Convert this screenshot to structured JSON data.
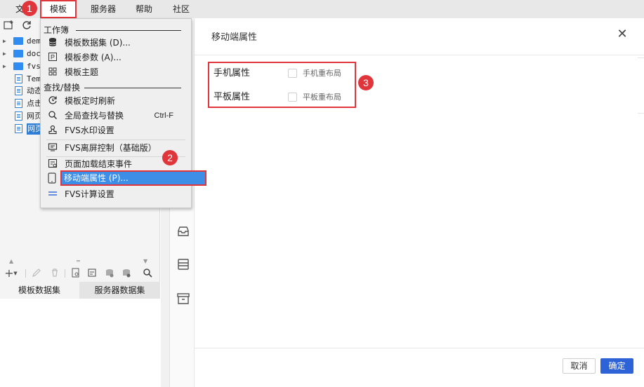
{
  "menubar": {
    "items": [
      "文",
      "模板",
      "服务器",
      "帮助",
      "社区"
    ]
  },
  "badges": [
    "1",
    "2",
    "3"
  ],
  "tree": {
    "items": [
      {
        "label": "dem",
        "type": "folder"
      },
      {
        "label": "doc",
        "type": "folder"
      },
      {
        "label": "fvs",
        "type": "folder"
      },
      {
        "label": "Tem",
        "type": "file"
      },
      {
        "label": "动态",
        "type": "file"
      },
      {
        "label": "点击",
        "type": "file"
      },
      {
        "label": "网页",
        "type": "file"
      },
      {
        "label": "网页",
        "type": "file",
        "selected": true
      }
    ]
  },
  "dataset_tabs": [
    "模板数据集",
    "服务器数据集"
  ],
  "dropdown": {
    "section1": "工作簿",
    "section2": "查找/替换",
    "items": [
      {
        "label": "模板数据集 (D)...",
        "icon": "database-icon"
      },
      {
        "label": "模板参数 (A)...",
        "icon": "parameter-icon"
      },
      {
        "label": "模板主题",
        "icon": "theme-grid-icon"
      },
      {
        "label": "模板定时刷新",
        "icon": "refresh-clock-icon"
      },
      {
        "label": "全局查找与替换",
        "icon": "search-replace-icon",
        "shortcut": "Ctrl-F"
      },
      {
        "label": "FVS水印设置",
        "icon": "watermark-stamp-icon"
      },
      {
        "label": "FVS离屏控制（基础版）",
        "icon": "offscreen-icon"
      },
      {
        "label": "页面加载结束事件",
        "icon": "event-icon"
      },
      {
        "label": "移动端属性 (P)...",
        "icon": "tablet-icon"
      },
      {
        "label": "FVS计算设置",
        "icon": "calc-lines-icon"
      }
    ]
  },
  "dialog": {
    "title": "移动端属性",
    "close": "✕",
    "phone_label": "手机属性",
    "phone_checkbox": "手机重布局",
    "tablet_label": "平板属性",
    "tablet_checkbox": "平板重布局",
    "cancel": "取消",
    "ok": "确定"
  },
  "colors": {
    "accent": "#3d8ee6",
    "annotation_red": "#e0353b",
    "primary_button": "#2d63d6"
  }
}
